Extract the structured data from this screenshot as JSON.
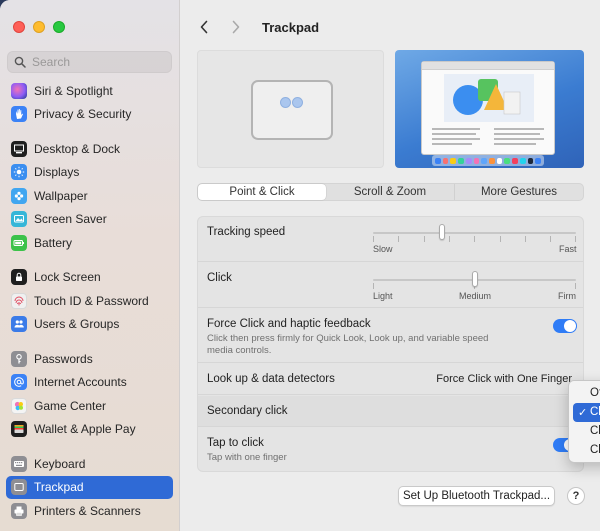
{
  "window": {
    "title": "Trackpad"
  },
  "search": {
    "placeholder": "Search"
  },
  "sidebar": {
    "items": [
      {
        "label": "Siri & Spotlight",
        "icon": "siri-icon",
        "color": "#8b5cf6"
      },
      {
        "label": "Privacy & Security",
        "icon": "hand-icon",
        "color": "#3b82f6"
      },
      {
        "label": "Desktop & Dock",
        "icon": "dock-icon",
        "color": "#1f1f1f"
      },
      {
        "label": "Displays",
        "icon": "sun-icon",
        "color": "#3b8ef0"
      },
      {
        "label": "Wallpaper",
        "icon": "flower-icon",
        "color": "#41a6f0"
      },
      {
        "label": "Screen Saver",
        "icon": "screen-saver-icon",
        "color": "#36b6d8"
      },
      {
        "label": "Battery",
        "icon": "battery-icon",
        "color": "#3cc24a"
      },
      {
        "label": "Lock Screen",
        "icon": "lock-icon",
        "color": "#1f1f1f"
      },
      {
        "label": "Touch ID & Password",
        "icon": "fingerprint-icon",
        "color": "#f0f0f0"
      },
      {
        "label": "Users & Groups",
        "icon": "users-icon",
        "color": "#3b7be8"
      },
      {
        "label": "Passwords",
        "icon": "key-icon",
        "color": "#8e8e93"
      },
      {
        "label": "Internet Accounts",
        "icon": "at-icon",
        "color": "#3b82f6"
      },
      {
        "label": "Game Center",
        "icon": "game-center-icon",
        "color": "#f0f0f0"
      },
      {
        "label": "Wallet & Apple Pay",
        "icon": "wallet-icon",
        "color": "#1f1f1f"
      },
      {
        "label": "Keyboard",
        "icon": "keyboard-icon",
        "color": "#8e8e93"
      },
      {
        "label": "Trackpad",
        "icon": "trackpad-icon",
        "color": "#8e8e93",
        "active": true
      },
      {
        "label": "Printers & Scanners",
        "icon": "printer-icon",
        "color": "#8e8e93"
      }
    ]
  },
  "tabs": [
    {
      "label": "Point & Click",
      "active": true
    },
    {
      "label": "Scroll & Zoom",
      "active": false
    },
    {
      "label": "More Gestures",
      "active": false
    }
  ],
  "settings": {
    "tracking_speed": {
      "label": "Tracking speed",
      "min_label": "Slow",
      "max_label": "Fast",
      "value": 0.34
    },
    "click": {
      "label": "Click",
      "labels": [
        "Light",
        "Medium",
        "Firm"
      ],
      "value": 0.5
    },
    "force_click": {
      "label": "Force Click and haptic feedback",
      "description": "Click then press firmly for Quick Look, Look up, and variable speed media controls.",
      "enabled": true
    },
    "lookup": {
      "label": "Look up & data detectors",
      "value": "Force Click with One Finger"
    },
    "secondary_click": {
      "label": "Secondary click"
    },
    "tap_to_click": {
      "label": "Tap to click",
      "description": "Tap with one finger",
      "enabled": true
    }
  },
  "secondary_click_menu": {
    "options": [
      {
        "label": "Off",
        "selected": false
      },
      {
        "label": "Click or Tap with Two Fingers",
        "selected": true
      },
      {
        "label": "Click in Bottom Right Corner",
        "selected": false
      },
      {
        "label": "Click in Bottom Left Corner",
        "selected": false
      }
    ]
  },
  "buttons": {
    "bluetooth": "Set Up Bluetooth Trackpad...",
    "help": "?"
  },
  "colors": {
    "accent": "#2f6ad6",
    "toggle_on": "#2f7cf6"
  }
}
